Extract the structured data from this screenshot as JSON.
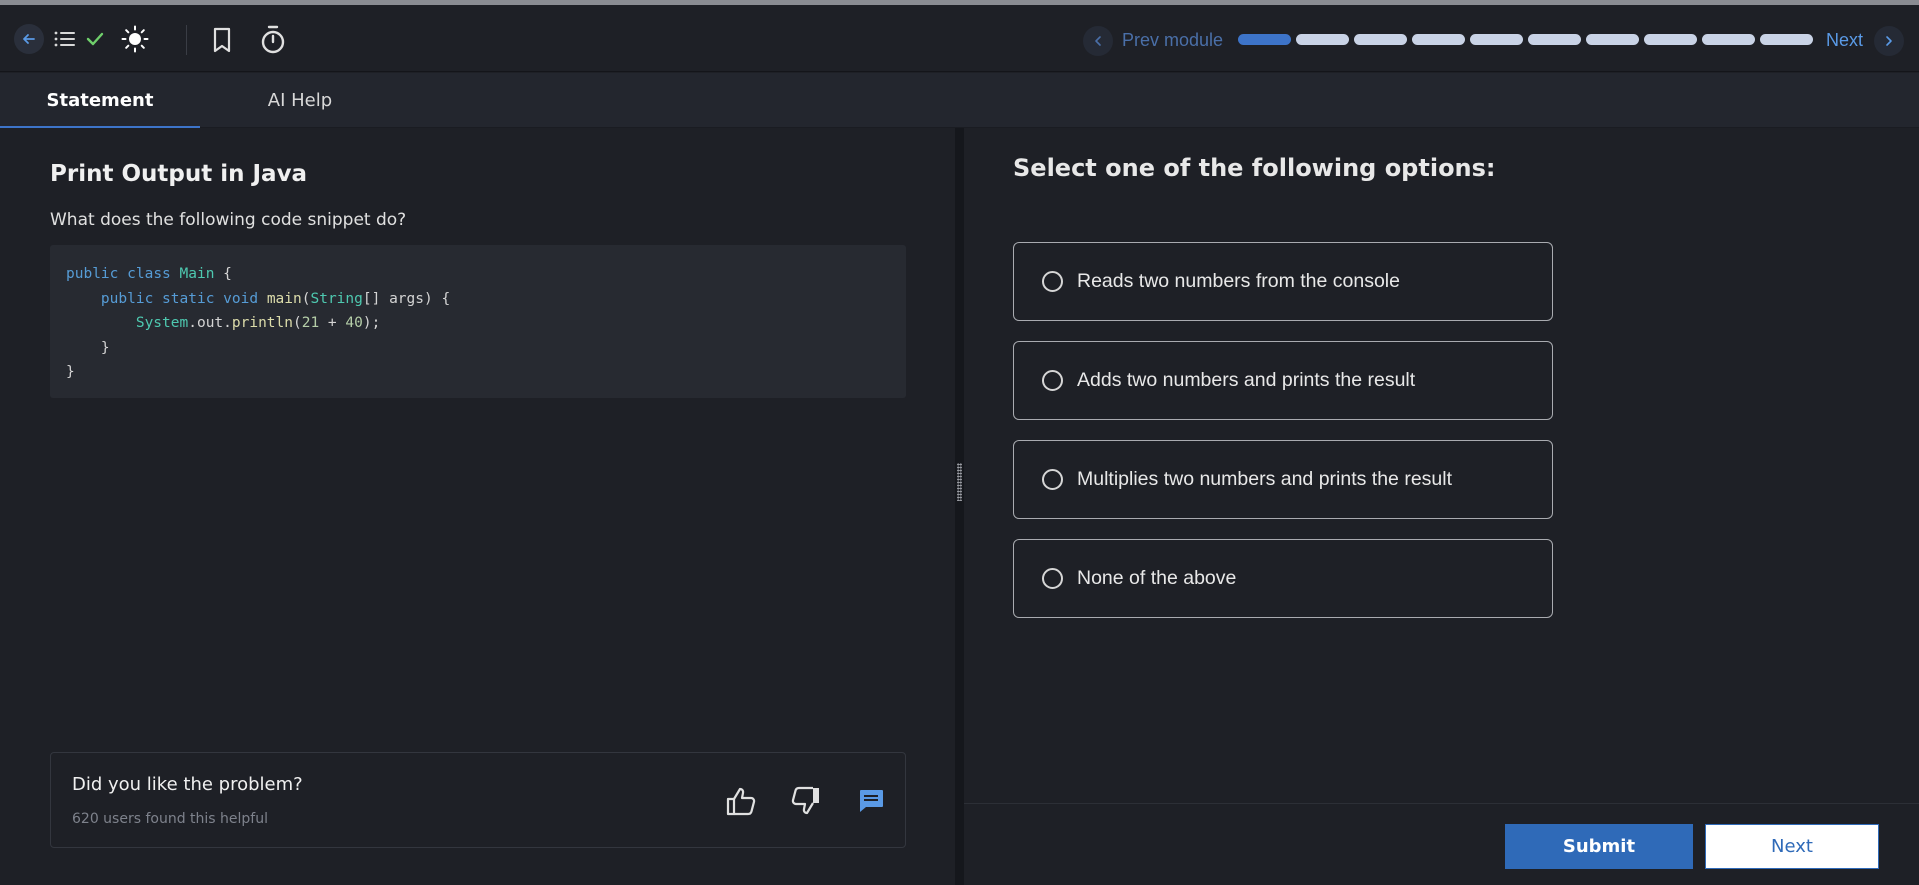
{
  "topbar": {
    "icons": [
      "back-arrow-icon",
      "list-icon",
      "check-icon",
      "sun-icon",
      "bookmark-icon",
      "stopwatch-icon"
    ],
    "prev_label": "Prev module",
    "next_label": "Next",
    "progress": {
      "total_segments": 10,
      "completed_segments": 1
    },
    "colors": {
      "accent": "#3d74c9",
      "check": "#6fcf6b"
    }
  },
  "tabs": [
    {
      "label": "Statement",
      "active": true
    },
    {
      "label": "AI Help",
      "active": false
    }
  ],
  "problem": {
    "title": "Print Output in Java",
    "description": "What does the following code snippet do?",
    "code": {
      "line1": {
        "kw1": "public",
        "kw2": "class",
        "name": "Main",
        "rest": " {"
      },
      "line2": {
        "indent": "    ",
        "kw1": "public",
        "kw2": "static",
        "kw3": "void",
        "fn": "main",
        "open": "(",
        "type": "String",
        "rest": "[] args) {"
      },
      "line3": {
        "indent": "        ",
        "type": "System",
        "mid": ".out.",
        "fn": "println",
        "open": "(",
        "n1": "21",
        "op": " + ",
        "n2": "40",
        "close": ");"
      },
      "line4": "    }",
      "line5": "}"
    }
  },
  "feedback": {
    "question": "Did you like the problem?",
    "count_text": "620 users found this helpful"
  },
  "quiz": {
    "heading": "Select one of the following options:",
    "options": [
      "Reads two numbers from the console",
      "Adds two numbers and prints the result",
      "Multiplies two numbers and prints the result",
      "None of the above"
    ],
    "submit_label": "Submit",
    "next_label": "Next"
  }
}
